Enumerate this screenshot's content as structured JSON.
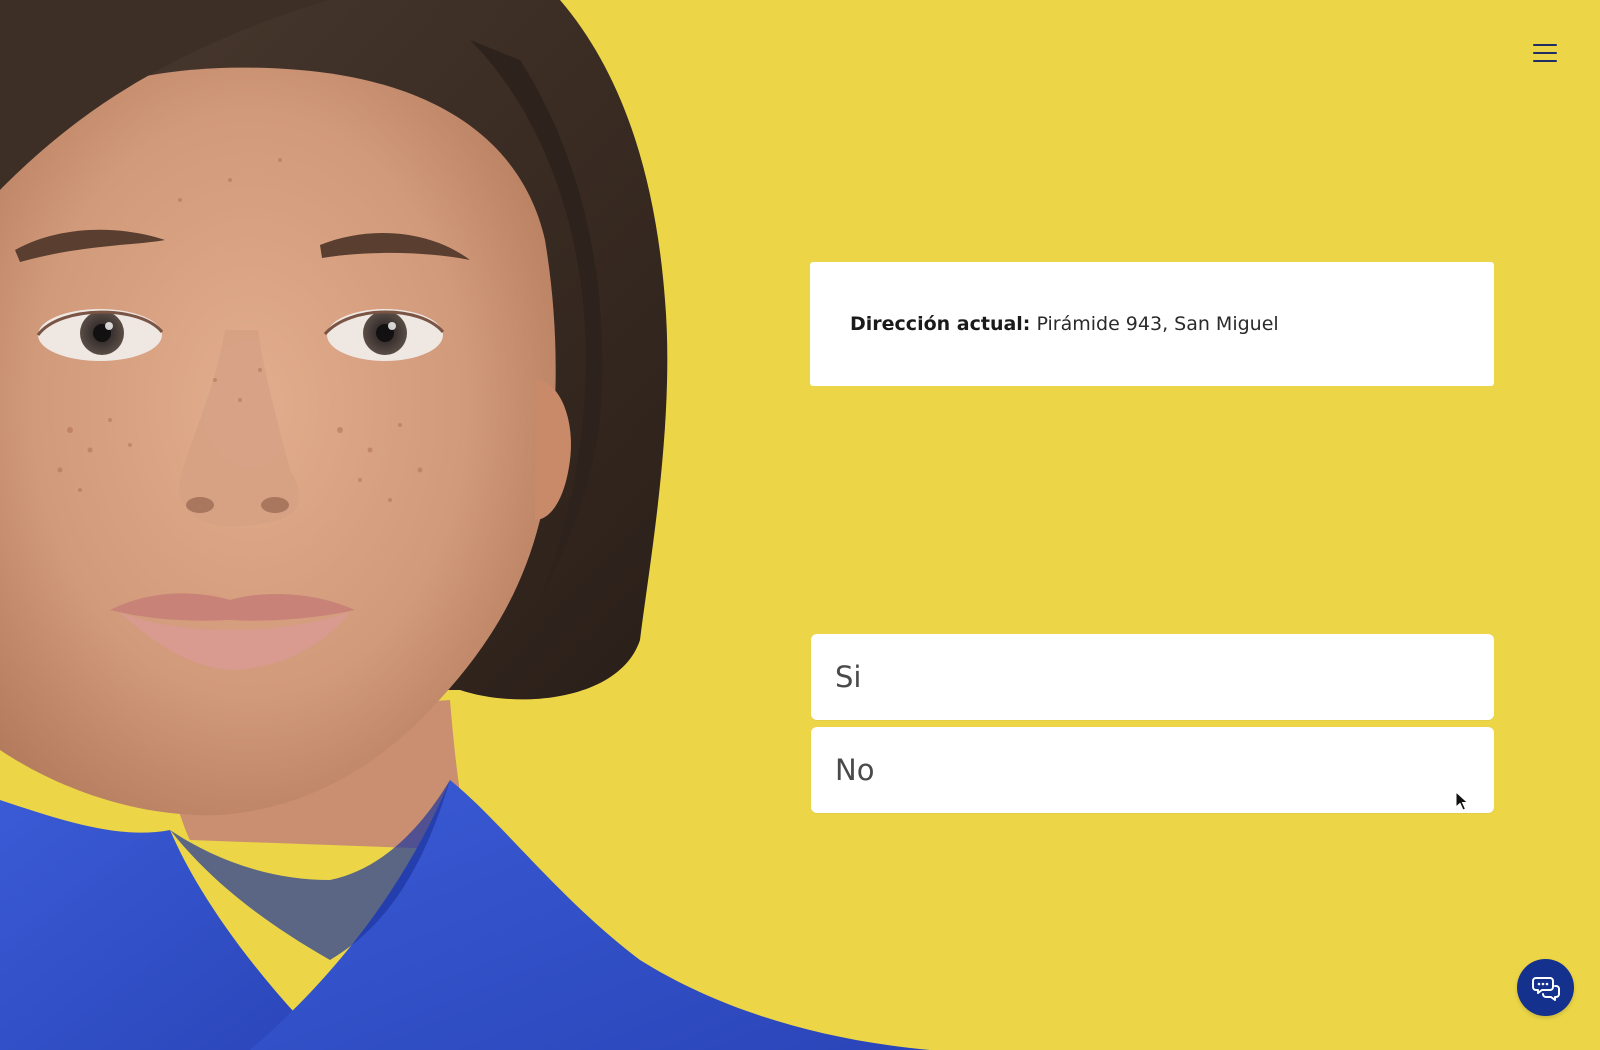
{
  "theme": {
    "background": "#ecd647",
    "card_background": "#ffffff",
    "chat_button_color": "#14318e",
    "avatar_shirt_color": "#2f4fc4"
  },
  "header": {
    "menu_icon": "hamburger-menu-icon"
  },
  "address_card": {
    "label": "Dirección actual:",
    "value": "Pirámide 943, San Miguel"
  },
  "options": [
    {
      "label": "Si"
    },
    {
      "label": "No"
    }
  ],
  "chat": {
    "icon": "chat-bubbles-icon"
  }
}
